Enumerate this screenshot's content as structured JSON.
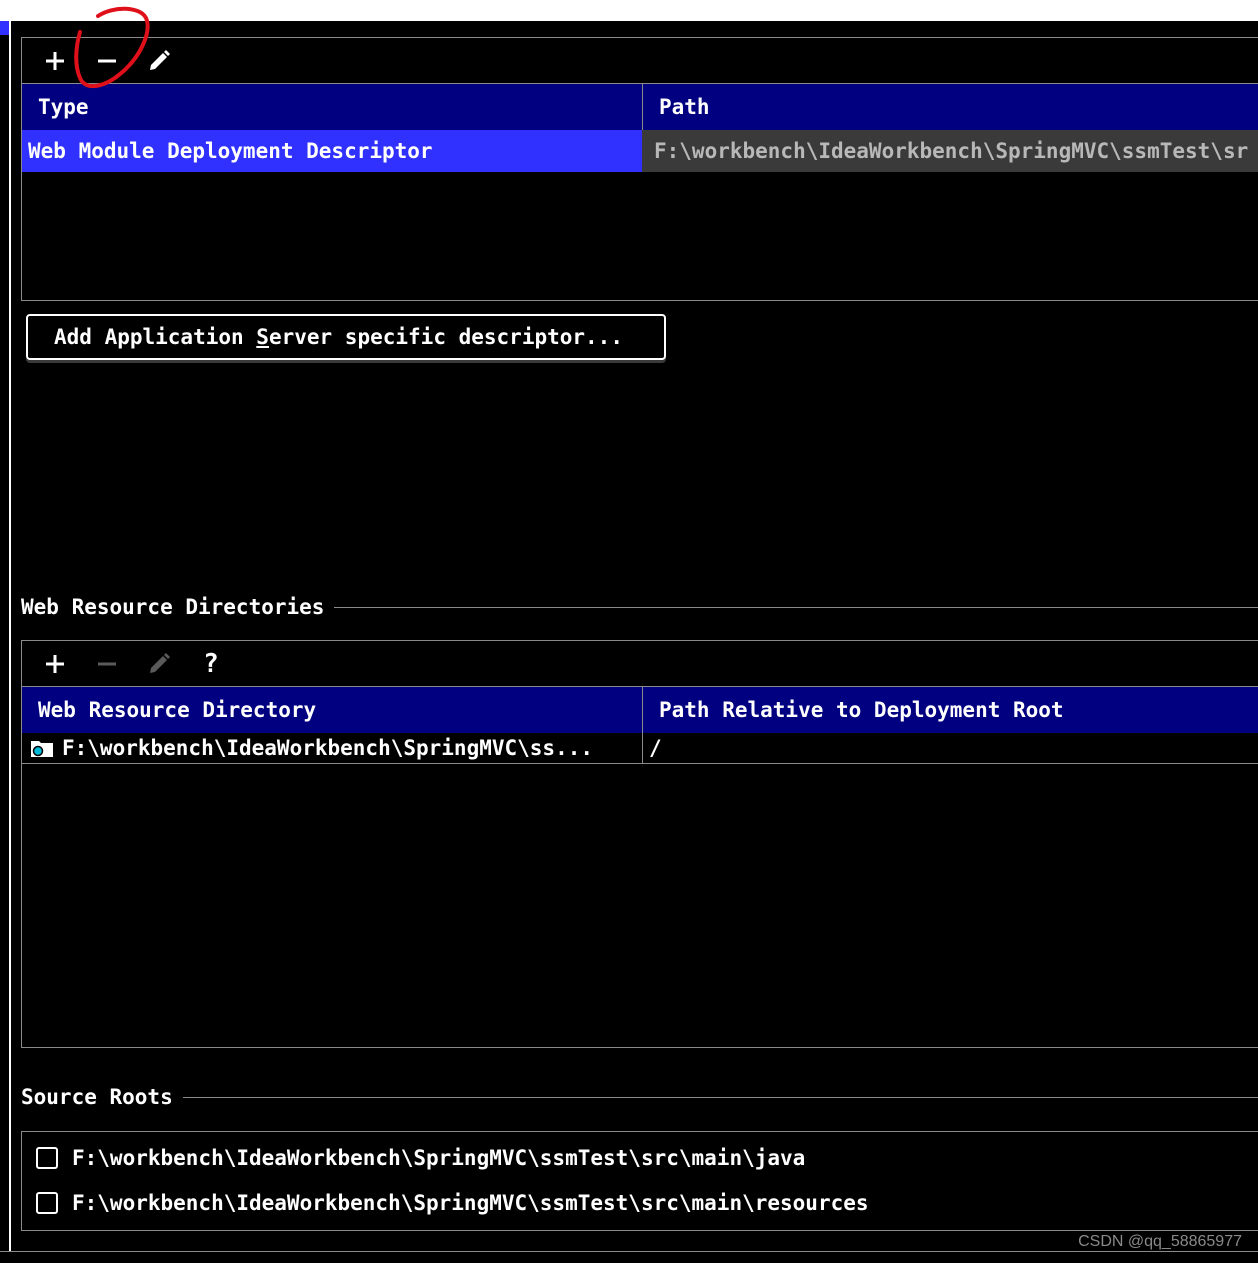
{
  "descriptors": {
    "toolbar": {
      "add_icon": "plus-icon",
      "remove_icon": "minus-icon",
      "edit_icon": "pencil-icon"
    },
    "columns": [
      "Type",
      "Path"
    ],
    "rows": [
      {
        "type": "Web Module Deployment Descriptor",
        "path": "F:\\workbench\\IdeaWorkbench\\SpringMVC\\ssmTest\\sr"
      }
    ],
    "add_server_button": {
      "before": "Add Application ",
      "mnemonic": "S",
      "after": "erver specific descriptor..."
    }
  },
  "web_resources": {
    "title": "Web Resource Directories",
    "toolbar": {
      "add_icon": "plus-icon",
      "remove_icon": "minus-icon",
      "edit_icon": "pencil-icon",
      "help": "?"
    },
    "columns": [
      "Web Resource Directory",
      "Path Relative to Deployment Root"
    ],
    "rows": [
      {
        "directory": "F:\\workbench\\IdeaWorkbench\\SpringMVC\\ss...",
        "relative_path": "/"
      }
    ]
  },
  "source_roots": {
    "title": "Source Roots",
    "items": [
      "F:\\workbench\\IdeaWorkbench\\SpringMVC\\ssmTest\\src\\main\\java",
      "F:\\workbench\\IdeaWorkbench\\SpringMVC\\ssmTest\\src\\main\\resources"
    ]
  },
  "watermark": "CSDN @qq_58865977",
  "colors": {
    "header_bg": "#000080",
    "selected_row_bg": "#3030ff",
    "path_cell_bg": "#3a3a3a",
    "annotation_red": "#e0101a",
    "border": "#8a8a8a"
  }
}
